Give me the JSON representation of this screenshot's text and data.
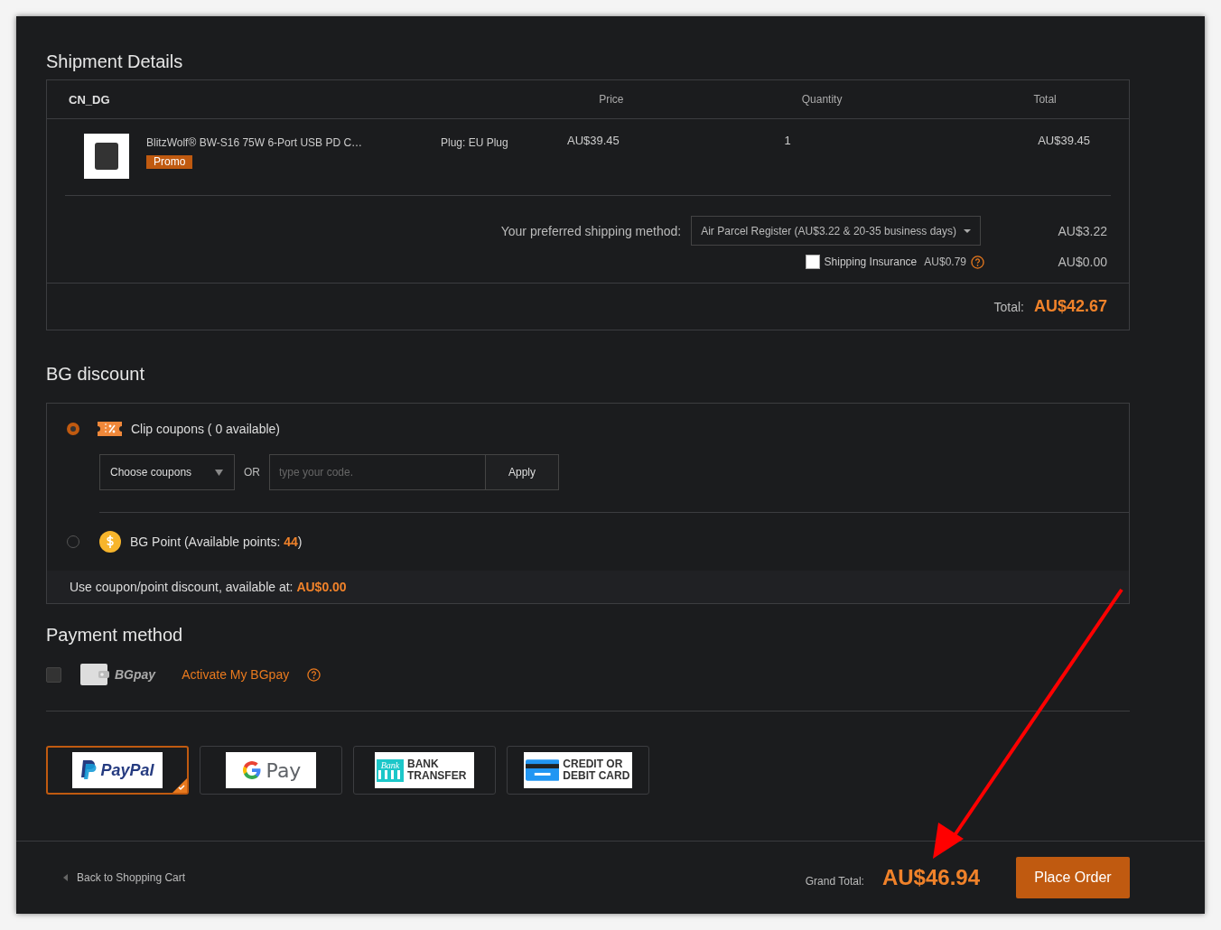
{
  "shipment": {
    "title": "Shipment Details",
    "warehouse": "CN_DG",
    "columns": [
      "Price",
      "Quantity",
      "Total"
    ],
    "items": [
      {
        "name": "BlitzWolf® BW-S16 75W 6-Port USB PD C…",
        "badge": "Promo",
        "option": "Plug: EU Plug",
        "price": "AU$39.45",
        "quantity": "1",
        "total": "AU$39.45"
      }
    ],
    "shipping_label": "Your preferred shipping method:",
    "shipping_method": "Air Parcel Register (AU$3.22 & 20-35 business days)",
    "shipping_cost": "AU$3.22",
    "insurance": {
      "label": "Shipping Insurance",
      "price": "AU$0.79",
      "checked": false,
      "amount": "AU$0.00"
    },
    "total_label": "Total:",
    "total": "AU$42.67"
  },
  "discount": {
    "title": "BG discount",
    "options": [
      {
        "kind": "coupon",
        "label": "Clip coupons ( 0 available)",
        "selected": true
      },
      {
        "kind": "points",
        "label": "BG Point (Available points: **44**)",
        "selected": false
      }
    ],
    "coupon_select": "Choose coupons",
    "or": "OR",
    "code_placeholder": "type your code.",
    "apply": "Apply",
    "note": "Use coupon/point discount, available at: **AU$0.00**"
  },
  "payment": {
    "title": "Payment method",
    "bgpay": {
      "checked": false,
      "logo": "BGpay",
      "link": "Activate My BGpay"
    },
    "methods": [
      {
        "kind": "paypal",
        "logo": "PayPal",
        "selected": true
      },
      {
        "kind": "gpay",
        "logo": "Pay",
        "selected": false
      },
      {
        "kind": "bank",
        "badge": "Bank",
        "logo": "BANK TRANSFER",
        "selected": false
      },
      {
        "kind": "card",
        "logo": "CREDIT OR DEBIT CARD",
        "selected": false
      }
    ]
  },
  "footer": {
    "back": "Back to Shopping Cart",
    "grand_label": "Grand Total:",
    "grand_total": "AU$46.94",
    "place_order": "Place Order"
  }
}
